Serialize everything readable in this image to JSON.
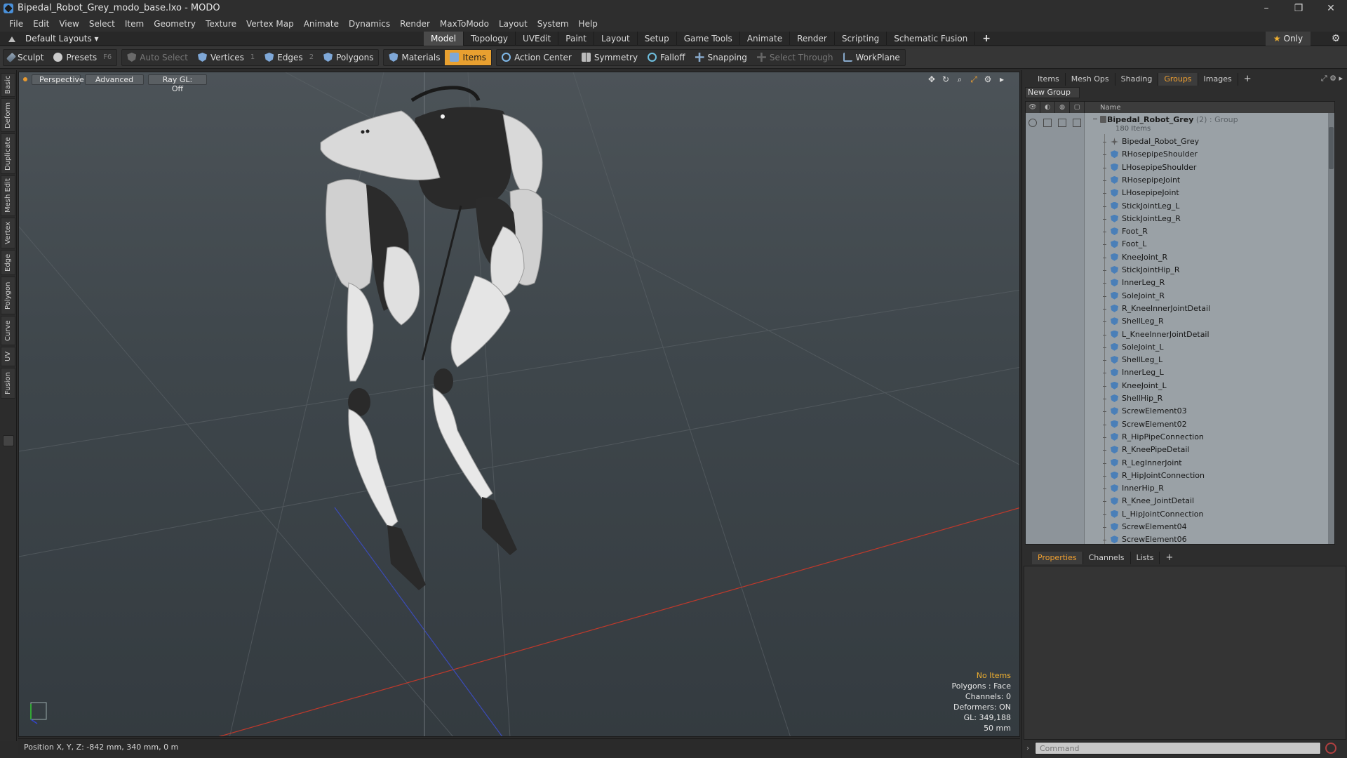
{
  "window": {
    "title": "Bipedal_Robot_Grey_modo_base.lxo - MODO",
    "controls": [
      "–",
      "❐",
      "✕"
    ]
  },
  "menu": [
    "File",
    "Edit",
    "View",
    "Select",
    "Item",
    "Geometry",
    "Texture",
    "Vertex Map",
    "Animate",
    "Dynamics",
    "Render",
    "MaxToModo",
    "Layout",
    "System",
    "Help"
  ],
  "layout_dropdown": "Default Layouts ▾",
  "layout_tabs": [
    {
      "label": "Model",
      "active": true
    },
    {
      "label": "Topology"
    },
    {
      "label": "UVEdit"
    },
    {
      "label": "Paint"
    },
    {
      "label": "Layout"
    },
    {
      "label": "Setup"
    },
    {
      "label": "Game Tools"
    },
    {
      "label": "Animate"
    },
    {
      "label": "Render"
    },
    {
      "label": "Scripting"
    },
    {
      "label": "Schematic Fusion"
    },
    {
      "label": "+"
    }
  ],
  "only_button": "Only",
  "toolbar": {
    "sculpt": "Sculpt",
    "presets": "Presets",
    "presets_key": "F6",
    "auto_select": "Auto Select",
    "vertices": "Vertices",
    "vertices_key": "1",
    "edges": "Edges",
    "edges_key": "2",
    "polygons": "Polygons",
    "materials": "Materials",
    "items": "Items",
    "action_center": "Action Center",
    "symmetry": "Symmetry",
    "falloff": "Falloff",
    "snapping": "Snapping",
    "select_through": "Select Through",
    "workplane": "WorkPlane"
  },
  "left_tabs": [
    "Basic",
    "Deform",
    "Duplicate",
    "Mesh Edit",
    "Vertex",
    "Edge",
    "Polygon",
    "Curve",
    "UV",
    "Fusion"
  ],
  "viewport": {
    "view": "Perspective",
    "shading": "Advanced",
    "raygl": "Ray GL: Off",
    "stats": {
      "selection": "No Items",
      "polygons": "Polygons : Face",
      "channels": "Channels: 0",
      "deformers": "Deformers: ON",
      "gl": "GL: 349,188",
      "focal": "50 mm"
    }
  },
  "status": "Position X, Y, Z:  -842 mm, 340 mm, 0 m",
  "right_panel": {
    "tabs": [
      {
        "label": "Items"
      },
      {
        "label": "Mesh Ops"
      },
      {
        "label": "Shading"
      },
      {
        "label": "Groups",
        "active": true
      },
      {
        "label": "Images"
      },
      {
        "label": "+"
      }
    ],
    "new_group": "New Group",
    "name_header": "Name",
    "root": {
      "name": "Bipedal_Robot_Grey",
      "meta": " (2) : Group",
      "sub": "180 Items"
    },
    "items": [
      "Bipedal_Robot_Grey",
      "RHosepipeShoulder",
      "LHosepipeShoulder",
      "RHosepipeJoint",
      "LHosepipeJoint",
      "StickJointLeg_L",
      "StickJointLeg_R",
      "Foot_R",
      "Foot_L",
      "KneeJoint_R",
      "StickJointHip_R",
      "InnerLeg_R",
      "SoleJoint_R",
      "R_KneeInnerJointDetail",
      "ShellLeg_R",
      "L_KneeInnerJointDetail",
      "SoleJoint_L",
      "ShellLeg_L",
      "InnerLeg_L",
      "KneeJoint_L",
      "ShellHip_R",
      "ScrewElement03",
      "ScrewElement02",
      "R_HipPipeConnection",
      "R_KneePipeDetail",
      "R_LegInnerJoint",
      "R_HipJointConnection",
      "InnerHip_R",
      "R_Knee_JointDetail",
      "L_HipJointConnection",
      "ScrewElement04",
      "ScrewElement06"
    ],
    "props_tabs": [
      {
        "label": "Properties",
        "active": true
      },
      {
        "label": "Channels"
      },
      {
        "label": "Lists"
      },
      {
        "label": "+"
      }
    ],
    "command_placeholder": "Command"
  },
  "colors": {
    "accent": "#e8a030",
    "viewport_top": "#4c5358",
    "viewport_bottom": "#343b40"
  }
}
